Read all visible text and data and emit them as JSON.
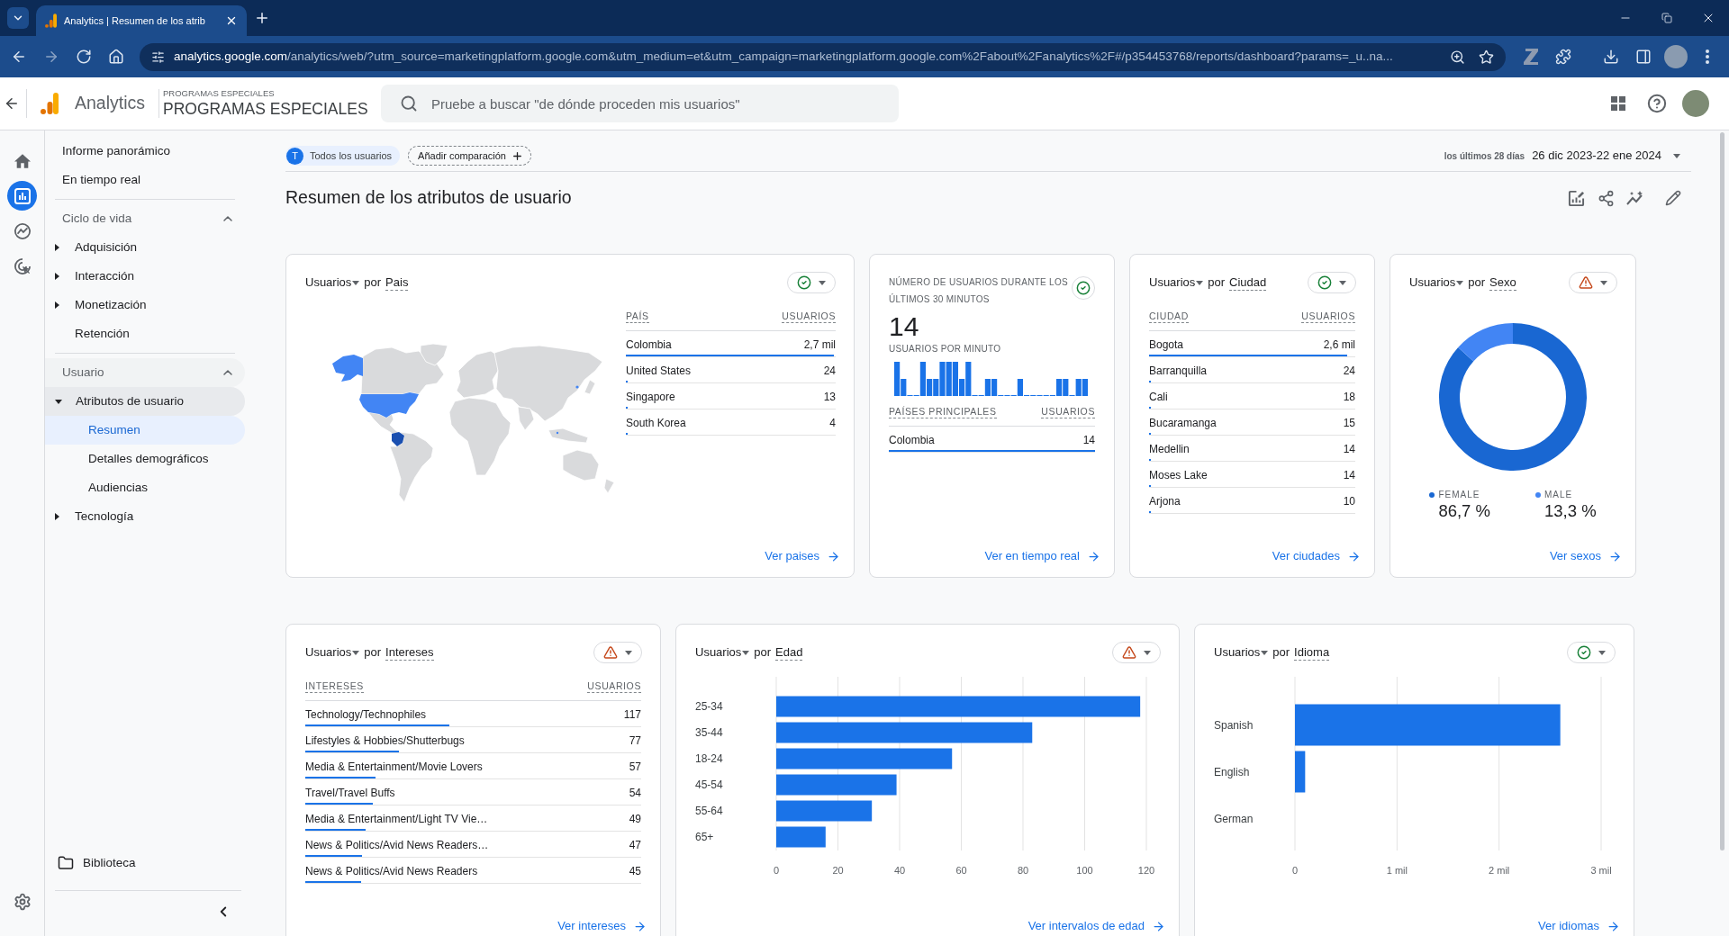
{
  "browser": {
    "tab": {
      "title": "Analytics | Resumen de los atrib",
      "selected": true
    },
    "url": {
      "host": "analytics.google.com",
      "path": "/analytics/web/?utm_source=marketingplatform.google.com&utm_medium=et&utm_campaign=marketingplatform.google.com%2Fabout%2Fanalytics%2F#/p354453768/reports/dashboard?params=_u..na..."
    }
  },
  "header": {
    "product": "Analytics",
    "account": "PROGRAMAS ESPECIALES",
    "property": "PROGRAMAS ESPECIALES",
    "search": {
      "placeholder": "Pruebe a buscar \"de dónde proceden mis usuarios\""
    }
  },
  "rail": [
    {
      "kind": "home",
      "selected": false
    },
    {
      "kind": "reports",
      "selected": true
    },
    {
      "kind": "explore",
      "selected": false
    },
    {
      "kind": "advertising",
      "selected": false
    }
  ],
  "sidebar": {
    "top_items": [
      {
        "label": "Informe panorámico",
        "selected": false
      },
      {
        "label": "En tiempo real",
        "selected": false
      }
    ],
    "sections": [
      {
        "title": "Ciclo de vida",
        "expanded": true,
        "items": [
          {
            "label": "Adquisición",
            "expanded": false,
            "selected": false
          },
          {
            "label": "Interacción",
            "expanded": false,
            "selected": false
          },
          {
            "label": "Monetización",
            "expanded": false,
            "selected": false
          },
          {
            "label": "Retención",
            "selected": false
          }
        ]
      },
      {
        "title": "Usuario",
        "expanded": true,
        "items": [
          {
            "label": "Atributos de usuario",
            "expanded": true,
            "selected": false,
            "children": [
              {
                "label": "Resumen",
                "selected": true
              },
              {
                "label": "Detalles demográficos",
                "selected": false
              },
              {
                "label": "Audiencias",
                "selected": false
              }
            ]
          },
          {
            "label": "Tecnología",
            "expanded": false,
            "selected": false
          }
        ]
      }
    ],
    "library": "Biblioteca"
  },
  "comparisons": {
    "chips": [
      {
        "initial": "T",
        "label": "Todos los usuarios"
      }
    ],
    "add_label": "Añadir comparación"
  },
  "date_range": {
    "caption": "los últimos 28 días",
    "value": "26 dic 2023-22 ene 2024"
  },
  "page_title": "Resumen de los atributos de usuario",
  "cards_top": [
    {
      "kind": "map_table",
      "title": {
        "metric": "Usuarios",
        "joiner": "por",
        "dimension": "Pais"
      },
      "warning": false,
      "columns": [
        "PAÍS",
        "USUARIOS"
      ],
      "rows": [
        {
          "name": "Colombia",
          "value": "2,7 mil",
          "level": 0.99
        },
        {
          "name": "United States",
          "value": "24",
          "level": 0.009
        },
        {
          "name": "Singapore",
          "value": "13",
          "level": 0.005
        },
        {
          "name": "South Korea",
          "value": "4",
          "level": 0.002
        }
      ],
      "link": "Ver paises"
    },
    {
      "kind": "realtime",
      "title": "NÚMERO DE USUARIOS DURANTE LOS ÚLTIMOS 30 MINUTOS",
      "warning": false,
      "count": "14",
      "subtitle": "USUARIOS POR MINUTO",
      "columns": [
        "PAÍSES PRINCIPALES",
        "USUARIOS"
      ],
      "rows": [
        {
          "name": "Colombia",
          "value": "14",
          "level": 1
        }
      ],
      "link": "Ver en tiempo real"
    },
    {
      "kind": "table",
      "title": {
        "metric": "Usuarios",
        "joiner": "por",
        "dimension": "Ciudad"
      },
      "warning": false,
      "columns": [
        "CIUDAD",
        "USUARIOS"
      ],
      "rows": [
        {
          "name": "Bogota",
          "value": "2,6 mil",
          "level": 0.96
        },
        {
          "name": "Barranquilla",
          "value": "24",
          "level": 0.009
        },
        {
          "name": "Cali",
          "value": "18",
          "level": 0.007
        },
        {
          "name": "Bucaramanga",
          "value": "15",
          "level": 0.006
        },
        {
          "name": "Medellin",
          "value": "14",
          "level": 0.005
        },
        {
          "name": "Moses Lake",
          "value": "14",
          "level": 0.005
        },
        {
          "name": "Arjona",
          "value": "10",
          "level": 0.004
        }
      ],
      "link": "Ver ciudades"
    },
    {
      "kind": "chart",
      "title": {
        "metric": "Usuarios",
        "joiner": "por",
        "dimension": "Sexo"
      },
      "warning": true,
      "chart_data": {
        "type": "donut",
        "categories": [
          "FEMALE",
          "MALE"
        ],
        "values": [
          86.7,
          13.3
        ]
      },
      "legend": [
        {
          "value": "86,7 %",
          "color": "#1967d2"
        },
        {
          "value": "13,3 %",
          "color": "#4285f4"
        }
      ],
      "link": "Ver sexos"
    }
  ],
  "cards_bottom": [
    {
      "kind": "table",
      "title": {
        "metric": "Usuarios",
        "joiner": "por",
        "dimension": "Intereses"
      },
      "warning": true,
      "columns": [
        "INTERESES",
        "USUARIOS"
      ],
      "rows": [
        {
          "name": "Technology/Technophiles",
          "value": "117",
          "level": 0.43
        },
        {
          "name": "Lifestyles & Hobbies/Shutterbugs",
          "value": "77",
          "level": 0.28
        },
        {
          "name": "Media & Entertainment/Movie Lovers",
          "value": "57",
          "level": 0.21
        },
        {
          "name": "Travel/Travel Buffs",
          "value": "54",
          "level": 0.2
        },
        {
          "name": "Media & Entertainment/Light TV Vie…",
          "value": "49",
          "level": 0.18
        },
        {
          "name": "News & Politics/Avid News Readers…",
          "value": "47",
          "level": 0.17
        },
        {
          "name": "News & Politics/Avid News Readers",
          "value": "45",
          "level": 0.165
        }
      ],
      "link": "Ver intereses"
    },
    {
      "kind": "chart",
      "title": {
        "metric": "Usuarios",
        "joiner": "por",
        "dimension": "Edad"
      },
      "warning": true,
      "chart_data": {
        "type": "bar",
        "orientation": "horizontal",
        "categories": [
          "25-34",
          "35-44",
          "18-24",
          "45-54",
          "55-64",
          "65+"
        ],
        "values": [
          118,
          83,
          57,
          39,
          31,
          16
        ],
        "xlim": [
          0,
          120
        ],
        "xticks": [
          0,
          20,
          40,
          60,
          80,
          100,
          120
        ],
        "grid": true
      },
      "link": "Ver intervalos de edad"
    },
    {
      "kind": "chart",
      "title": {
        "metric": "Usuarios",
        "joiner": "por",
        "dimension": "Idioma"
      },
      "warning": false,
      "chart_data": {
        "type": "bar",
        "orientation": "horizontal",
        "categories": [
          "Spanish",
          "English",
          "German"
        ],
        "values": [
          2.6,
          0.1,
          0
        ],
        "xlim": [
          0,
          3
        ],
        "xticks": [
          0,
          {
            "value": 1,
            "label": "1 mil"
          },
          {
            "value": 2,
            "label": "2 mil"
          },
          {
            "value": 3,
            "label": "3 mil"
          }
        ],
        "grid": true
      },
      "link": "Ver idiomas"
    }
  ]
}
